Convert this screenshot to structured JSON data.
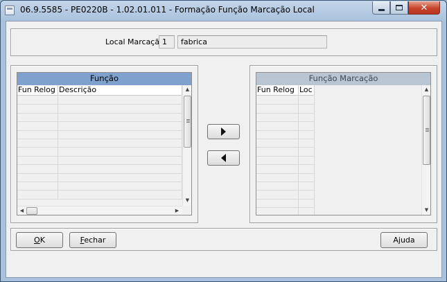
{
  "window": {
    "title": "06.9.5585 - PE0220B - 1.02.01.011 - Formação Função Marcação Local",
    "controls": [
      "minimize-icon",
      "maximize-icon",
      "close-icon"
    ]
  },
  "local": {
    "label": "Local Marcação:",
    "code": "1",
    "description": "fabrica"
  },
  "left_grid": {
    "title": "Função",
    "columns": [
      "Fun Relog",
      "Descrição"
    ],
    "rows": [
      [],
      [],
      [],
      [],
      [],
      [],
      [],
      [],
      [],
      [],
      [],
      []
    ]
  },
  "right_grid": {
    "title": "Função Marcação",
    "columns": [
      "Fun Relog",
      "Loc"
    ],
    "rows": [
      [],
      [],
      [],
      [],
      [],
      [],
      [],
      [],
      [],
      [],
      [],
      [],
      [],
      [],
      []
    ]
  },
  "transfer": {
    "add_icon": "arrow-right-icon",
    "remove_icon": "arrow-left-icon"
  },
  "buttons": {
    "ok_mnemonic": "O",
    "ok_rest": "K",
    "fechar_mnemonic": "F",
    "fechar_rest": "echar",
    "ajuda": "Ajuda"
  }
}
